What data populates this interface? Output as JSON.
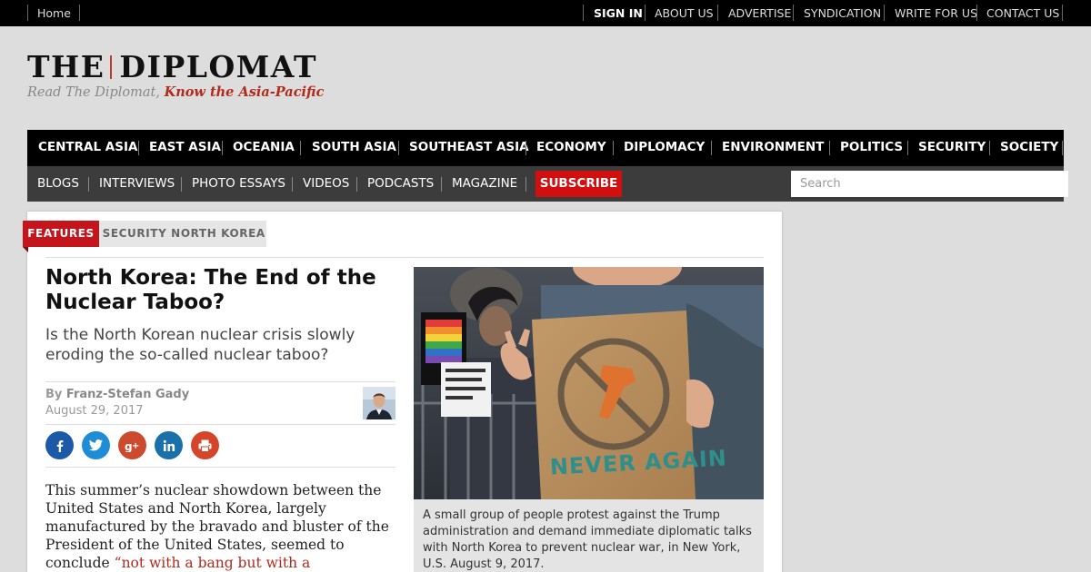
{
  "topbar": {
    "home": "Home",
    "links": [
      "SIGN IN",
      "ABOUT US",
      "ADVERTISE",
      "SYNDICATION",
      "WRITE FOR US",
      "CONTACT US"
    ]
  },
  "logo": {
    "part1": "THE",
    "part2": "DIPLOMAT",
    "tagline_plain": "Read The Diplomat, ",
    "tagline_bold": "Know the Asia-Pacific"
  },
  "nav_primary": [
    "CENTRAL ASIA",
    "EAST ASIA",
    "OCEANIA",
    "SOUTH ASIA",
    "SOUTHEAST ASIA",
    "ECONOMY",
    "DIPLOMACY",
    "ENVIRONMENT",
    "POLITICS",
    "SECURITY",
    "SOCIETY"
  ],
  "nav_secondary": [
    "BLOGS",
    "INTERVIEWS",
    "PHOTO ESSAYS",
    "VIDEOS",
    "PODCASTS",
    "MAGAZINE"
  ],
  "subscribe_label": "SUBSCRIBE",
  "search": {
    "placeholder": "Search"
  },
  "article": {
    "tags": [
      "FEATURES",
      "SECURITY",
      "NORTH KOREA"
    ],
    "headline": "North Korea: The End of the Nuclear Taboo?",
    "dek": "Is the North Korean nuclear crisis slowly eroding the so-called nuclear taboo?",
    "byline_prefix": "By ",
    "author": "Franz-Stefan Gady",
    "date": "August 29, 2017",
    "share_icons": [
      "facebook-icon",
      "twitter-icon",
      "google-plus-icon",
      "linkedin-icon",
      "print-icon"
    ],
    "body_start": "This summer’s nuclear showdown between the United States and North Korea, largely manufactured by the bravado and bluster of the President of the United States, seemed to conclude ",
    "body_quote": "“not with a bang but with a",
    "photo_sign_text": "NEVER AGAIN",
    "caption": "A small group of people protest against the Trump administration and demand immediate diplomatic talks with North Korea to prevent nuclear war, in New York, U.S. August 9, 2017."
  },
  "colors": {
    "brand_red": "#c4141c",
    "subscribe_red": "#d10f0f",
    "facebook": "#1c5aa8",
    "twitter": "#1f8dd6",
    "google_plus": "#cc4a2e",
    "linkedin": "#1970aa",
    "print": "#d5452a"
  }
}
